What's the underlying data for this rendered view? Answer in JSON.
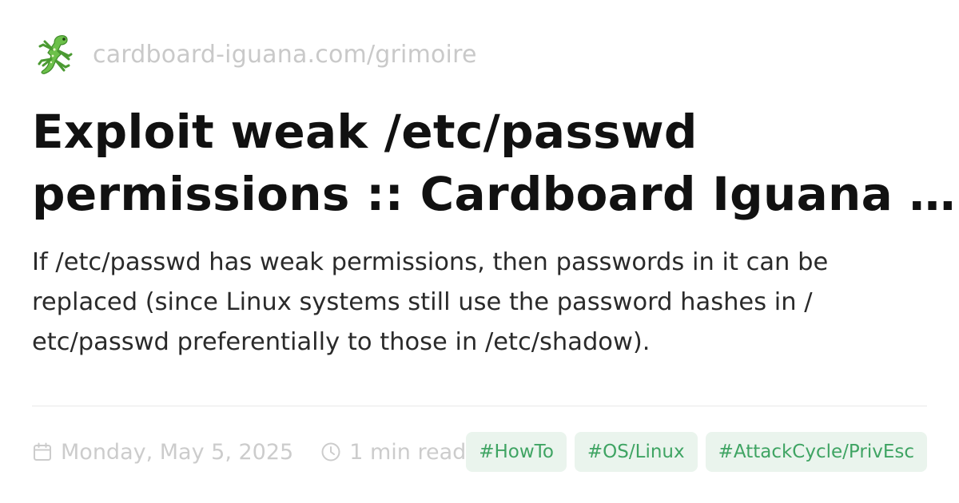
{
  "site": {
    "logo_icon": "iguana-emoji-icon",
    "url": "cardboard-iguana.com/grimoire"
  },
  "title": {
    "line1": "Exploit weak /etc/passwd",
    "line2": "permissions :: Cardboard Iguana …"
  },
  "description": {
    "line1": "If /etc/passwd has weak permissions, then passwords in it can be",
    "line2": "replaced (since Linux systems still use the password hashes in /",
    "line3": "etc/passwd preferentially to those in /etc/shadow)."
  },
  "meta": {
    "date_icon": "calendar-icon",
    "date": "Monday, May 5, 2025",
    "read_icon": "clock-icon",
    "read_time": "1 min read"
  },
  "tags": [
    "#HowTo",
    "#OS/Linux",
    "#AttackCycle/PrivEsc"
  ],
  "colors": {
    "tag_bg": "#eaf4ed",
    "tag_text": "#3fa463",
    "muted": "#cccccc",
    "iguana_green": "#6cc04a"
  }
}
